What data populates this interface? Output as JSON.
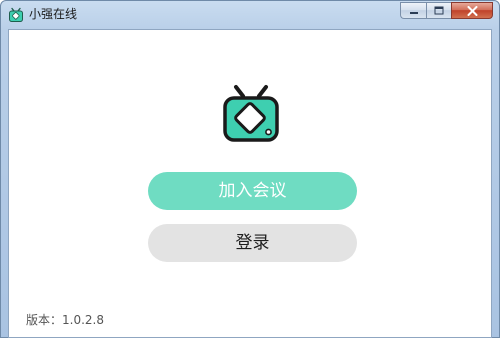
{
  "window": {
    "title": "小强在线",
    "accent_color": "#3ecfb0"
  },
  "main": {
    "logo_icon": "tv-icon",
    "join_meeting_label": "加入会议",
    "login_label": "登录"
  },
  "footer": {
    "version_label": "版本：1.0.2.8"
  }
}
